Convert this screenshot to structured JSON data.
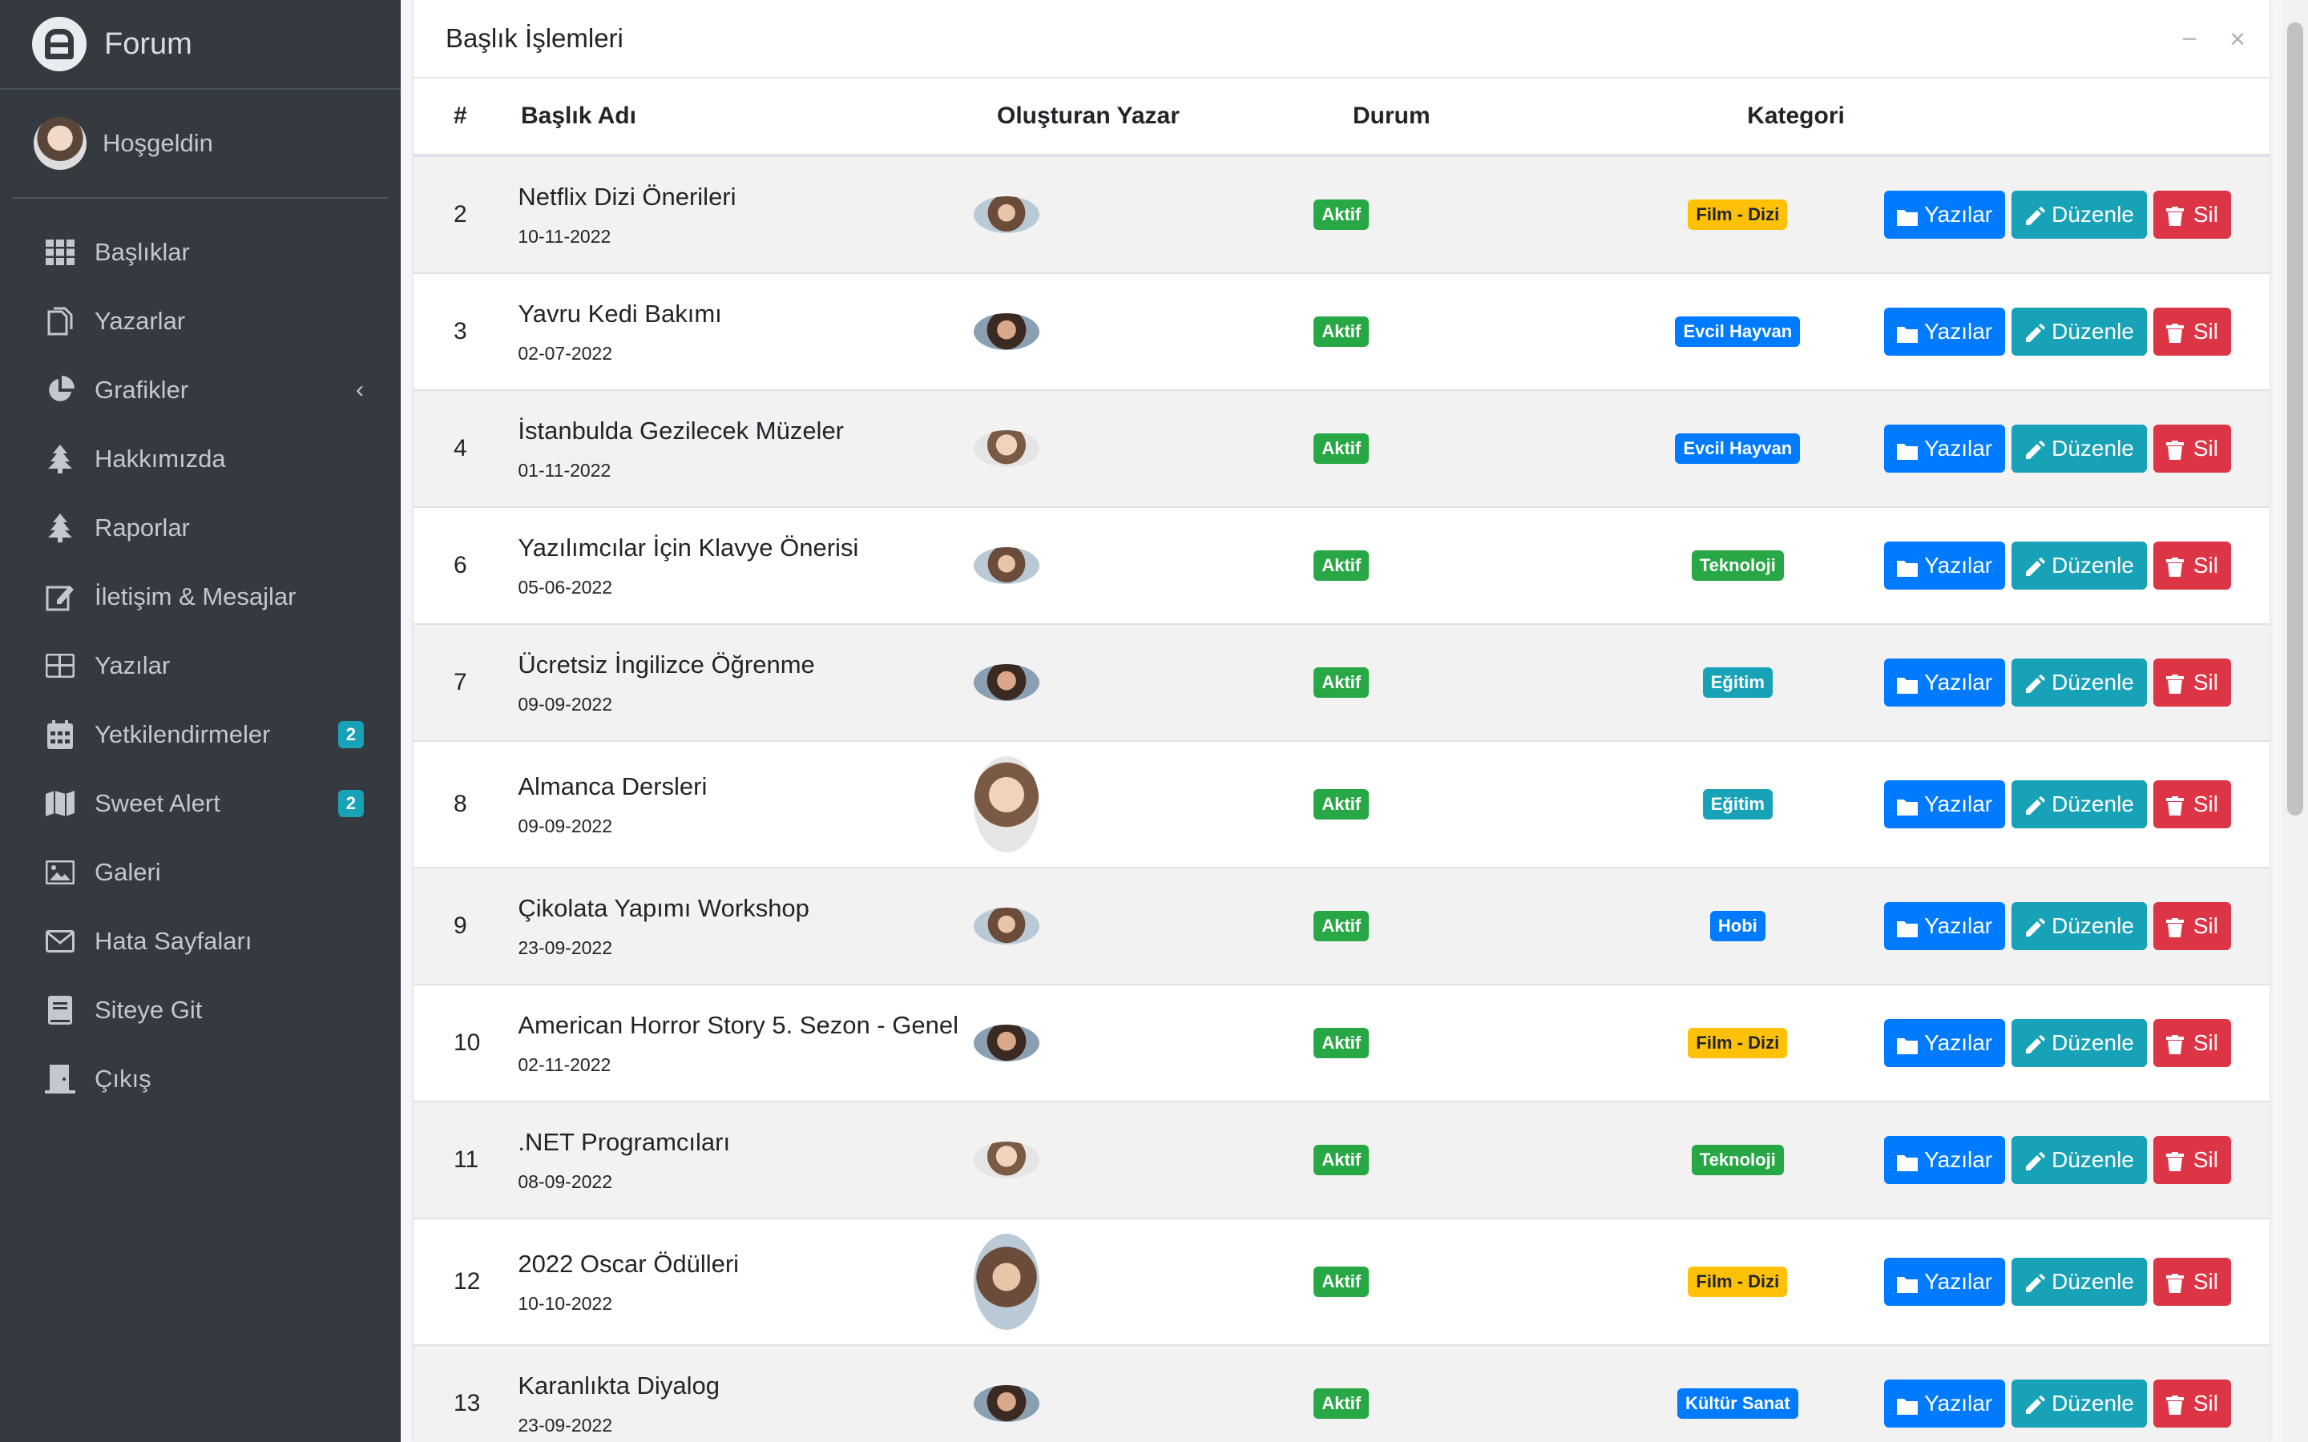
{
  "brand": {
    "title": "Forum"
  },
  "user": {
    "greeting": "Hoşgeldin"
  },
  "sidebar": {
    "items": [
      {
        "label": "Başlıklar",
        "icon": "grid-icon"
      },
      {
        "label": "Yazarlar",
        "icon": "copy-icon"
      },
      {
        "label": "Grafikler",
        "icon": "pie-chart-icon"
      },
      {
        "label": "Hakkımızda",
        "icon": "tree-icon"
      },
      {
        "label": "Raporlar",
        "icon": "tree-icon"
      },
      {
        "label": "İletişim & Mesajlar",
        "icon": "edit-icon"
      },
      {
        "label": "Yazılar",
        "icon": "table-icon"
      },
      {
        "label": "Yetkilendirmeler",
        "icon": "calendar-icon",
        "badge": "2"
      },
      {
        "label": "Sweet Alert",
        "icon": "map-icon",
        "badge": "2"
      },
      {
        "label": "Galeri",
        "icon": "image-icon"
      },
      {
        "label": "Hata Sayfaları",
        "icon": "envelope-icon"
      },
      {
        "label": "Siteye Git",
        "icon": "book-icon"
      },
      {
        "label": "Çıkış",
        "icon": "door-icon"
      }
    ]
  },
  "card": {
    "title": "Başlık İşlemleri",
    "minimize": "−",
    "close": "×"
  },
  "table": {
    "headers": {
      "num": "#",
      "title": "Başlık Adı",
      "author": "Oluşturan Yazar",
      "status": "Durum",
      "category": "Kategori"
    },
    "buttons": {
      "posts": "Yazılar",
      "edit": "Düzenle",
      "delete": "Sil"
    },
    "rows": [
      {
        "num": "2",
        "title": "Netflix Dizi Önerileri",
        "date": "10-11-2022",
        "status": "Aktif",
        "category": "Film - Dizi",
        "cat_color": "#ffc107",
        "cat_text": "#212529",
        "avatar": "wide"
      },
      {
        "num": "3",
        "title": "Yavru Kedi Bakımı",
        "date": "02-07-2022",
        "status": "Aktif",
        "category": "Evcil Hayvan",
        "cat_color": "#007bff",
        "cat_text": "#ffffff",
        "avatar": "wide"
      },
      {
        "num": "4",
        "title": "İstanbulda Gezilecek Müzeler",
        "date": "01-11-2022",
        "status": "Aktif",
        "category": "Evcil Hayvan",
        "cat_color": "#007bff",
        "cat_text": "#ffffff",
        "avatar": "wide"
      },
      {
        "num": "6",
        "title": "Yazılımcılar İçin Klavye Önerisi",
        "date": "05-06-2022",
        "status": "Aktif",
        "category": "Teknoloji",
        "cat_color": "#28a745",
        "cat_text": "#ffffff",
        "avatar": "wide"
      },
      {
        "num": "7",
        "title": "Ücretsiz İngilizce Öğrenme",
        "date": "09-09-2022",
        "status": "Aktif",
        "category": "Eğitim",
        "cat_color": "#17a2b8",
        "cat_text": "#ffffff",
        "avatar": "wide"
      },
      {
        "num": "8",
        "title": "Almanca Dersleri",
        "date": "09-09-2022",
        "status": "Aktif",
        "category": "Eğitim",
        "cat_color": "#17a2b8",
        "cat_text": "#ffffff",
        "avatar": "tall"
      },
      {
        "num": "9",
        "title": "Çikolata Yapımı Workshop",
        "date": "23-09-2022",
        "status": "Aktif",
        "category": "Hobi",
        "cat_color": "#007bff",
        "cat_text": "#ffffff",
        "avatar": "wide"
      },
      {
        "num": "10",
        "title": "American Horror Story 5. Sezon - Genel",
        "date": "02-11-2022",
        "status": "Aktif",
        "category": "Film - Dizi",
        "cat_color": "#ffc107",
        "cat_text": "#212529",
        "avatar": "wide"
      },
      {
        "num": "11",
        "title": ".NET Programcıları",
        "date": "08-09-2022",
        "status": "Aktif",
        "category": "Teknoloji",
        "cat_color": "#28a745",
        "cat_text": "#ffffff",
        "avatar": "wide"
      },
      {
        "num": "12",
        "title": "2022 Oscar Ödülleri",
        "date": "10-10-2022",
        "status": "Aktif",
        "category": "Film - Dizi",
        "cat_color": "#ffc107",
        "cat_text": "#212529",
        "avatar": "tall"
      },
      {
        "num": "13",
        "title": "Karanlıkta Diyalog",
        "date": "23-09-2022",
        "status": "Aktif",
        "category": "Kültür Sanat",
        "cat_color": "#007bff",
        "cat_text": "#ffffff",
        "avatar": "wide"
      }
    ]
  }
}
